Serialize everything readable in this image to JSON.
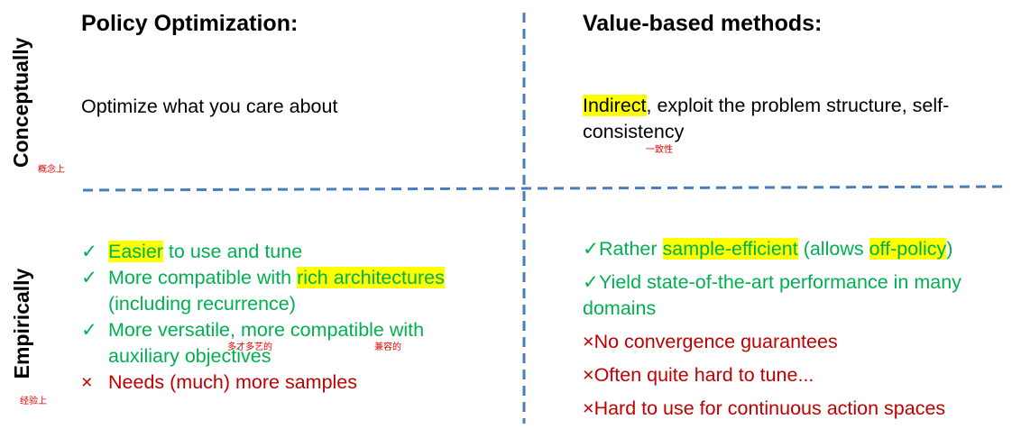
{
  "rows": {
    "top": {
      "label": "Conceptually",
      "note": "概念上"
    },
    "bottom": {
      "label": "Empirically",
      "note": "经验上"
    }
  },
  "left": {
    "title": "Policy Optimization:",
    "concept": "Optimize what you care about",
    "items": [
      {
        "mark": "✓",
        "kind": "pro",
        "parts": [
          {
            "t": "Easier",
            "hl": true
          },
          {
            "t": " to use and tune"
          }
        ]
      },
      {
        "mark": "✓",
        "kind": "pro",
        "parts": [
          {
            "t": "More compatible with "
          },
          {
            "t": "rich architectures",
            "hl": true
          },
          {
            "t": " (including recurrence)"
          }
        ]
      },
      {
        "mark": "✓",
        "kind": "pro",
        "parts": [
          {
            "t": "More versatile, more compatible with auxiliary objectives"
          }
        ]
      },
      {
        "mark": "×",
        "kind": "con",
        "parts": [
          {
            "t": "Needs (much) more samples"
          }
        ]
      }
    ],
    "notes": {
      "versatile": "多才多艺的",
      "compatible": "兼容的"
    }
  },
  "right": {
    "title": "Value-based methods:",
    "concept_highlight": "Indirect",
    "concept_rest": ", exploit the problem structure, self-consistency",
    "concept_note": "一致性",
    "items": [
      {
        "mark": "✓",
        "kind": "pro",
        "parts": [
          {
            "t": "Rather "
          },
          {
            "t": "sample-efficient",
            "hl": true
          },
          {
            "t": " (allows "
          },
          {
            "t": "off-policy",
            "hl": true
          },
          {
            "t": ")"
          }
        ]
      },
      {
        "mark": "✓",
        "kind": "pro",
        "parts": [
          {
            "t": "Yield state-of-the-art performance in many domains"
          }
        ]
      },
      {
        "mark": "×",
        "kind": "con",
        "parts": [
          {
            "t": "No convergence guarantees"
          }
        ]
      },
      {
        "mark": "×",
        "kind": "con",
        "parts": [
          {
            "t": "Often quite hard to tune..."
          }
        ]
      },
      {
        "mark": "×",
        "kind": "con",
        "parts": [
          {
            "t": "Hard to use for continuous action spaces"
          }
        ]
      }
    ]
  },
  "colors": {
    "divider": "#4a7ebb",
    "pro": "#00b050",
    "con": "#c00000",
    "highlight": "#ffff00",
    "note": "#e00000"
  }
}
